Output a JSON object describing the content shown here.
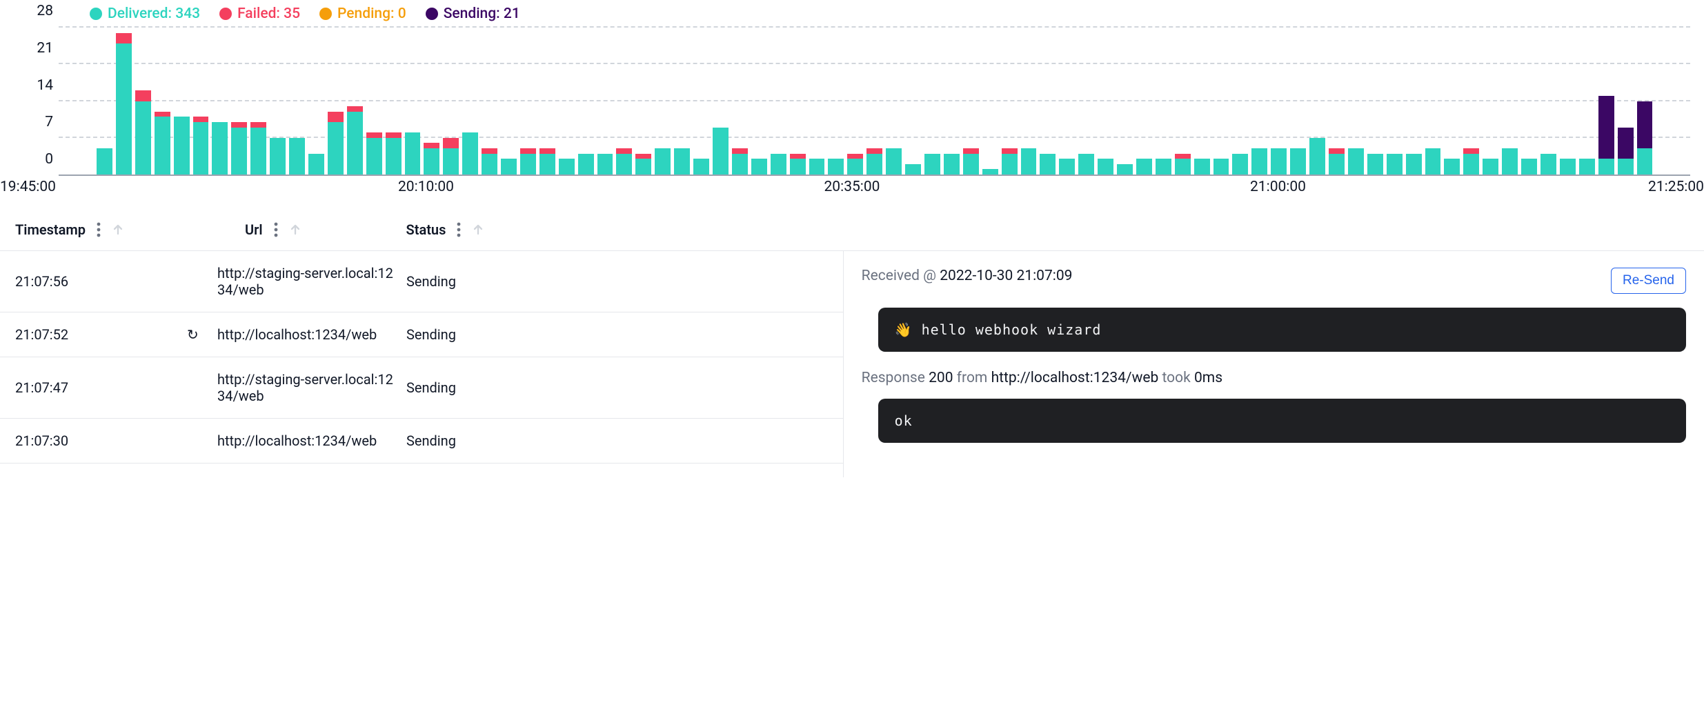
{
  "colors": {
    "delivered": "#2dd4bf",
    "failed": "#f43f5e",
    "pending": "#f59e0b",
    "sending": "#3b0764"
  },
  "legend": [
    {
      "label": "Delivered",
      "value": 343,
      "color": "#2dd4bf"
    },
    {
      "label": "Failed",
      "value": 35,
      "color": "#f43f5e"
    },
    {
      "label": "Pending",
      "value": 0,
      "color": "#f59e0b"
    },
    {
      "label": "Sending",
      "value": 21,
      "color": "#3b0764"
    }
  ],
  "chart_data": {
    "type": "bar",
    "title": "",
    "xlabel": "",
    "ylabel": "",
    "ylim": [
      0,
      28
    ],
    "yticks": [
      0,
      7,
      14,
      21,
      28
    ],
    "xticks": [
      "19:45:00",
      "20:10:00",
      "20:35:00",
      "21:00:00",
      "21:25:00"
    ],
    "xtick_positions_pct": [
      0,
      25,
      50,
      75,
      100
    ],
    "categories_implied": "minutes between 19:45 and 21:25",
    "series": [
      {
        "name": "Delivered",
        "values": [
          5,
          25,
          14,
          11,
          11,
          10,
          10,
          9,
          9,
          7,
          7,
          4,
          10,
          12,
          7,
          7,
          8,
          5,
          5,
          8,
          4,
          3,
          4,
          4,
          3,
          4,
          4,
          4,
          3,
          5,
          5,
          3,
          9,
          4,
          3,
          4,
          3,
          3,
          3,
          3,
          4,
          5,
          2,
          4,
          4,
          4,
          1,
          4,
          5,
          4,
          3,
          4,
          3,
          2,
          3,
          3,
          3,
          3,
          3,
          4,
          5,
          5,
          5,
          7,
          4,
          5,
          4,
          4,
          4,
          5,
          3,
          4,
          3,
          5,
          3,
          4,
          3,
          3,
          3,
          3,
          5
        ]
      },
      {
        "name": "Failed",
        "values": [
          0,
          2,
          2,
          1,
          0,
          1,
          0,
          1,
          1,
          0,
          0,
          0,
          2,
          1,
          1,
          1,
          0,
          1,
          2,
          0,
          1,
          0,
          1,
          1,
          0,
          0,
          0,
          1,
          1,
          0,
          0,
          0,
          0,
          1,
          0,
          0,
          1,
          0,
          0,
          1,
          1,
          0,
          0,
          0,
          0,
          1,
          0,
          1,
          0,
          0,
          0,
          0,
          0,
          0,
          0,
          0,
          1,
          0,
          0,
          0,
          0,
          0,
          0,
          0,
          1,
          0,
          0,
          0,
          0,
          0,
          0,
          1,
          0,
          0,
          0,
          0,
          0,
          0,
          0,
          0,
          0
        ]
      },
      {
        "name": "Sending",
        "values": [
          0,
          0,
          0,
          0,
          0,
          0,
          0,
          0,
          0,
          0,
          0,
          0,
          0,
          0,
          0,
          0,
          0,
          0,
          0,
          0,
          0,
          0,
          0,
          0,
          0,
          0,
          0,
          0,
          0,
          0,
          0,
          0,
          0,
          0,
          0,
          0,
          0,
          0,
          0,
          0,
          0,
          0,
          0,
          0,
          0,
          0,
          0,
          0,
          0,
          0,
          0,
          0,
          0,
          0,
          0,
          0,
          0,
          0,
          0,
          0,
          0,
          0,
          0,
          0,
          0,
          0,
          0,
          0,
          0,
          0,
          0,
          0,
          0,
          0,
          0,
          0,
          0,
          0,
          12,
          6,
          9
        ]
      }
    ]
  },
  "columns": {
    "timestamp": "Timestamp",
    "url": "Url",
    "status": "Status"
  },
  "rows": [
    {
      "timestamp": "21:07:56",
      "resend_icon": false,
      "url": "http://staging-server.local:1234/web",
      "status": "Sending"
    },
    {
      "timestamp": "21:07:52",
      "resend_icon": true,
      "url": "http://localhost:1234/web",
      "status": "Sending"
    },
    {
      "timestamp": "21:07:47",
      "resend_icon": false,
      "url": "http://staging-server.local:1234/web",
      "status": "Sending"
    },
    {
      "timestamp": "21:07:30",
      "resend_icon": false,
      "url": "http://localhost:1234/web",
      "status": "Sending"
    }
  ],
  "detail": {
    "received_prefix": "Received @ ",
    "received_at": "2022-10-30 21:07:09",
    "resend_label": "Re-Send",
    "payload": "👋 hello webhook wizard",
    "response": {
      "prefix": "Response ",
      "status": "200",
      "from_word": " from ",
      "url": "http://localhost:1234/web",
      "took_word": " took ",
      "latency": "0ms",
      "body": "ok"
    }
  }
}
